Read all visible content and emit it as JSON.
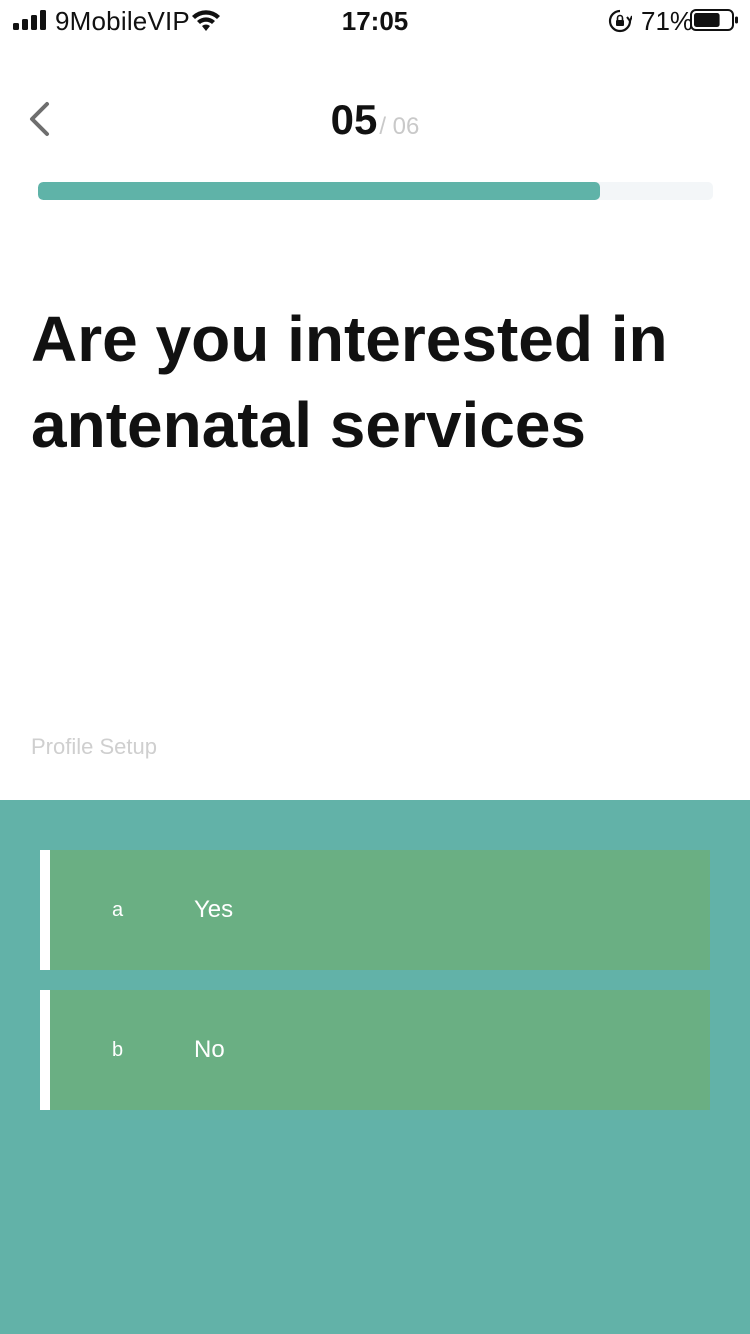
{
  "status_bar": {
    "carrier": "9MobileVIP",
    "time": "17:05",
    "battery_percent": "71%",
    "battery_level": 0.71,
    "icons": [
      "cellular-signal-icon",
      "wifi-icon",
      "rotation-lock-icon",
      "battery-icon"
    ]
  },
  "header": {
    "back_icon": "chevron-left-icon",
    "step_current": "05",
    "step_total": "/ 06",
    "progress_fraction": 0.833
  },
  "question": {
    "title": "Are you interested in antenatal services"
  },
  "section_label": "Profile Setup",
  "options": [
    {
      "letter": "a",
      "label": "Yes"
    },
    {
      "letter": "b",
      "label": "No"
    }
  ],
  "colors": {
    "accent": "#5fb3a8",
    "panel": "#62b2a8",
    "option": "#6aaf83",
    "progress_track": "#f3f6f8"
  }
}
